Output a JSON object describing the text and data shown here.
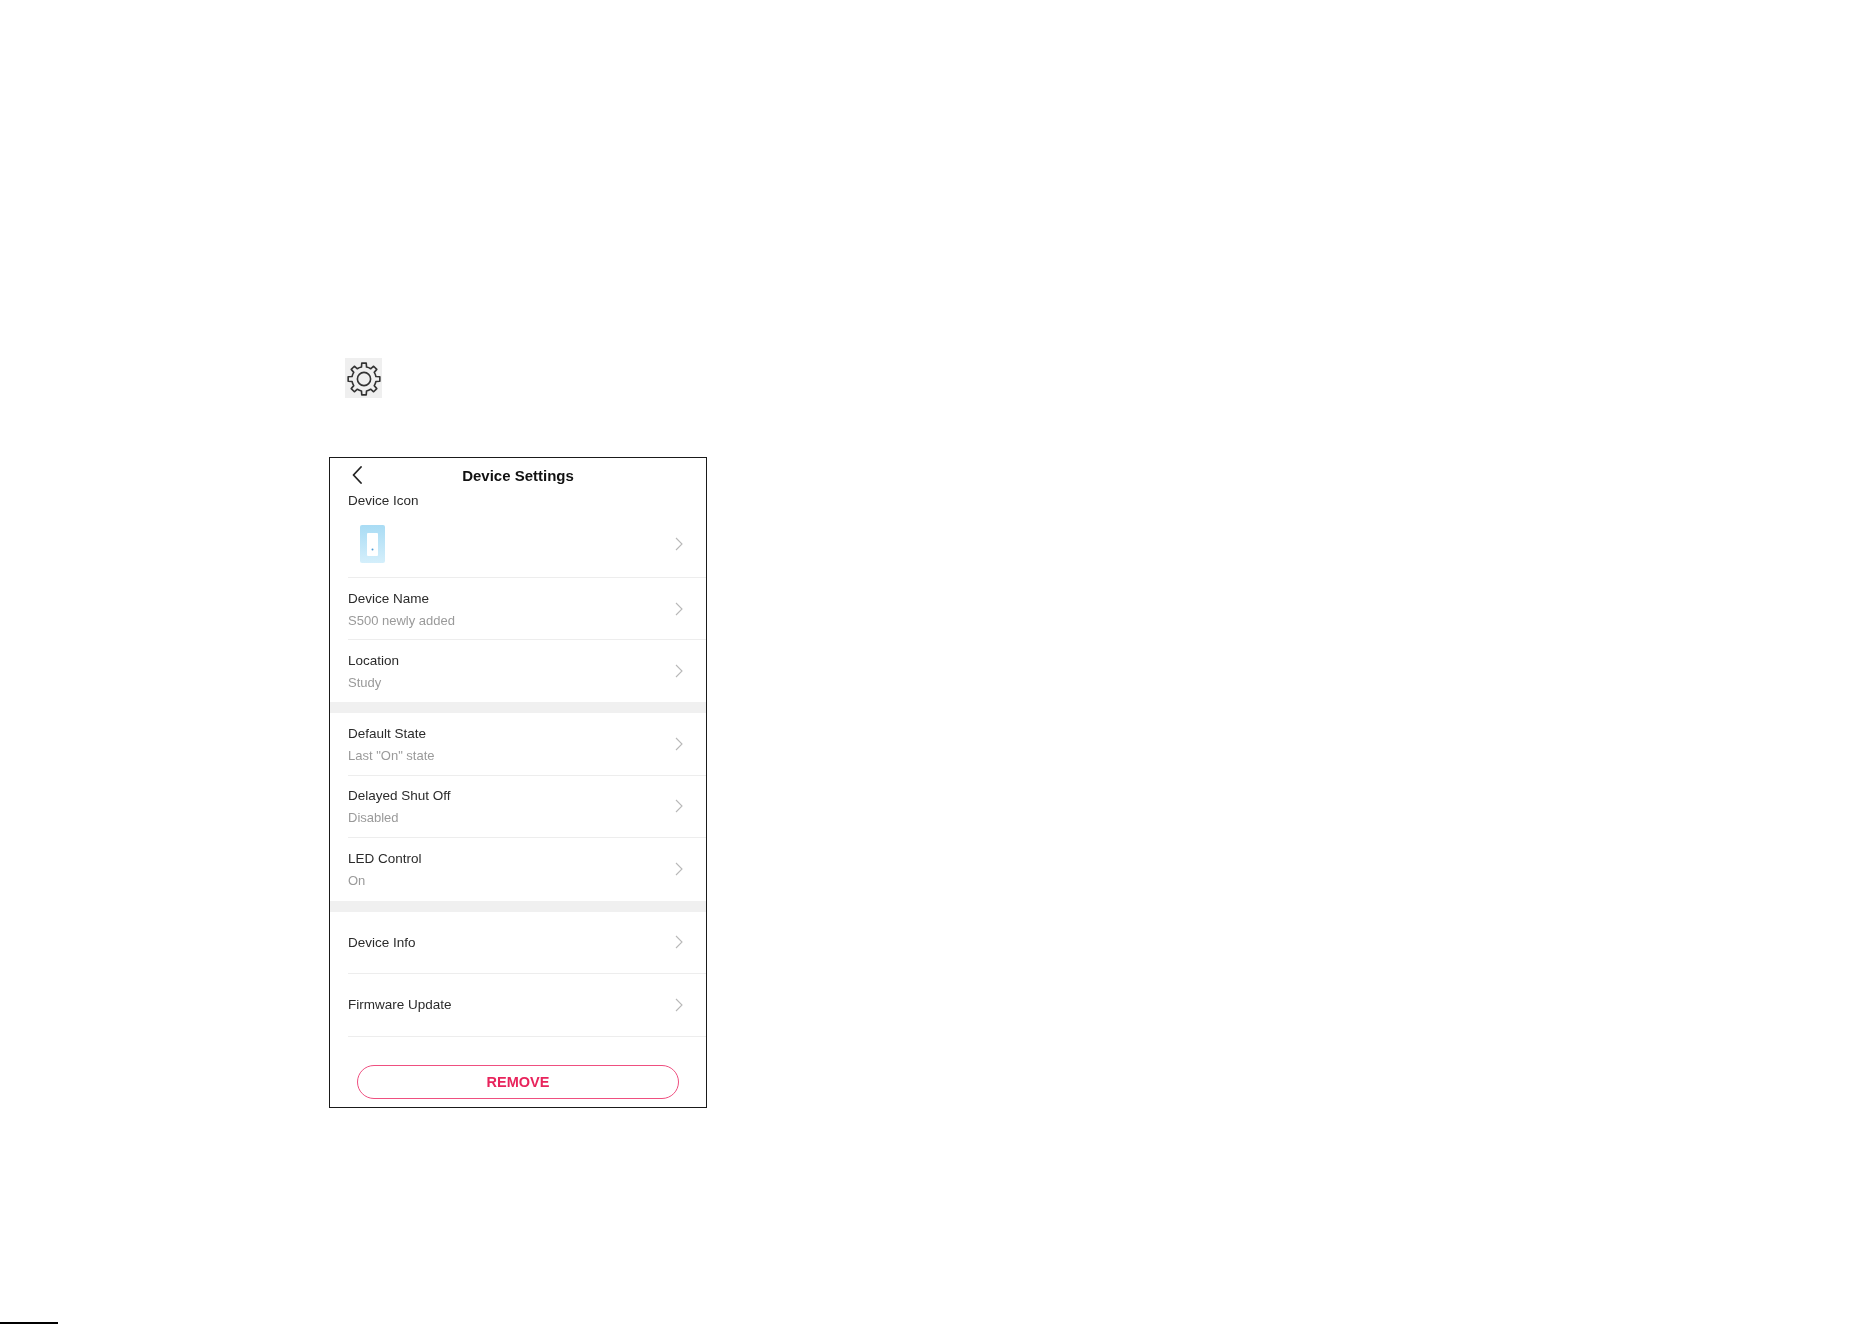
{
  "settings_screen": {
    "title": "Device Settings",
    "sections": [
      {
        "items": [
          {
            "kind": "icon",
            "label": "Device Icon"
          },
          {
            "kind": "detail",
            "label": "Device Name",
            "value": "S500 newly added"
          },
          {
            "kind": "detail",
            "label": "Location",
            "value": "Study"
          }
        ]
      },
      {
        "items": [
          {
            "kind": "detail",
            "label": "Default State",
            "value": "Last \"On\" state"
          },
          {
            "kind": "detail",
            "label": "Delayed Shut Off",
            "value": "Disabled"
          },
          {
            "kind": "detail",
            "label": "LED Control",
            "value": "On"
          }
        ]
      },
      {
        "items": [
          {
            "kind": "link",
            "label": "Device Info"
          },
          {
            "kind": "link",
            "label": "Firmware Update"
          }
        ]
      }
    ],
    "remove_button": "REMOVE"
  }
}
